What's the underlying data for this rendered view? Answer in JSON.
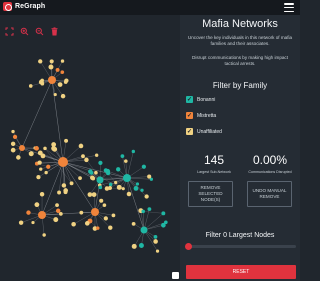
{
  "app": {
    "name": "ReGraph"
  },
  "colors": {
    "accent": "#e0333e",
    "bonanni": "#1fb7a4",
    "mistretta": "#f0843b",
    "unaffiliated": "#f0d283",
    "background": "#20262d"
  },
  "toolbar": {
    "icons": [
      "fit-screen-icon",
      "zoom-in-icon",
      "zoom-out-icon",
      "trash-icon"
    ]
  },
  "panel": {
    "title": "Mafia Networks",
    "description1": "Uncover the key individuals in this network of mafia families and their associates.",
    "description2": "Disrupt communications by making high impact tactical arrests.",
    "filter_title": "Filter by Family",
    "families": [
      {
        "label": "Bonanni",
        "checked": true,
        "color": "#1fb7a4"
      },
      {
        "label": "Mistretta",
        "checked": true,
        "color": "#f0843b"
      },
      {
        "label": "Unaffiliated",
        "checked": true,
        "color": "#f0d283"
      }
    ],
    "stats": {
      "largest_value": "145",
      "largest_label": "Largest Sub-Network",
      "disrupted_value": "0.00%",
      "disrupted_label": "Communications Disrupted"
    },
    "buttons": {
      "remove": "REMOVE SELECTED NODE(S)",
      "undo": "UNDO MANUAL REMOVE"
    },
    "largest_filter": {
      "label": "Filter 0 Largest Nodes",
      "value": 0
    },
    "reset_label": "RESET"
  }
}
